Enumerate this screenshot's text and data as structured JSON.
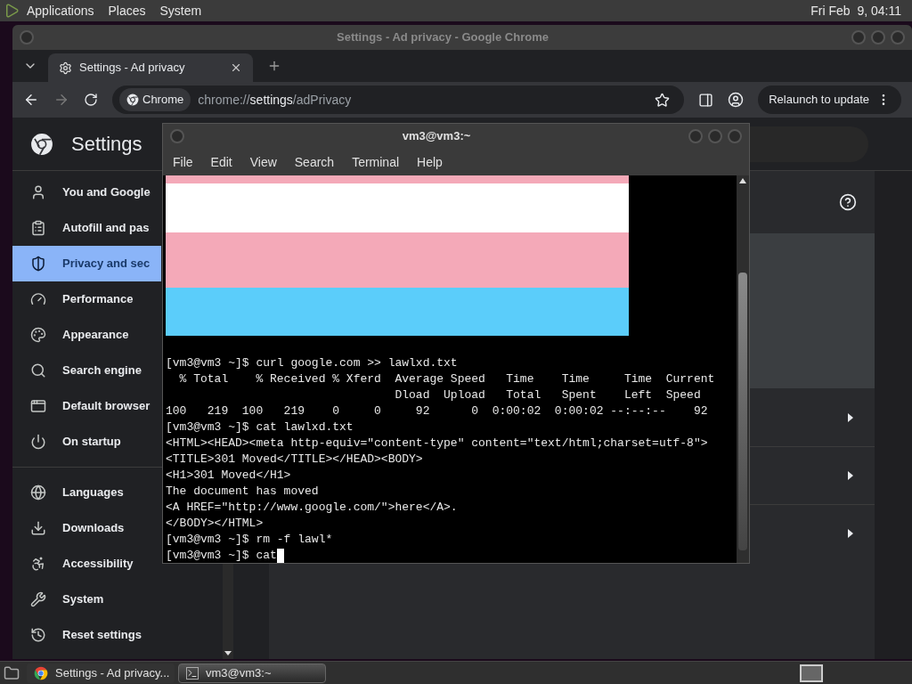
{
  "top_panel": {
    "menus": [
      "Applications",
      "Places",
      "System"
    ],
    "clock": "Fri Feb  9, 04:11"
  },
  "browser": {
    "title": "Settings - Ad privacy - Google Chrome",
    "tab": {
      "label": "Settings - Ad privacy",
      "selected": true
    },
    "omnibox": {
      "chip": "Chrome",
      "url_scheme": "chrome://",
      "url_host": "settings",
      "url_path": "/adPrivacy"
    },
    "relaunch_button": "Relaunch to update",
    "settings": {
      "title": "Settings",
      "nav": [
        {
          "label": "You and Google",
          "selected": false
        },
        {
          "label": "Autofill and pas",
          "selected": false
        },
        {
          "label": "Privacy and sec",
          "selected": true
        },
        {
          "label": "Performance",
          "selected": false
        },
        {
          "label": "Appearance",
          "selected": false
        },
        {
          "label": "Search engine",
          "selected": false
        },
        {
          "label": "Default browser",
          "selected": false
        },
        {
          "label": "On startup",
          "selected": false
        },
        {
          "label": "Languages",
          "selected": false
        },
        {
          "label": "Downloads",
          "selected": false
        },
        {
          "label": "Accessibility",
          "selected": false
        },
        {
          "label": "System",
          "selected": false
        },
        {
          "label": "Reset settings",
          "selected": false
        }
      ]
    }
  },
  "terminal": {
    "title": "vm3@vm3:~",
    "menus": [
      "File",
      "Edit",
      "View",
      "Search",
      "Terminal",
      "Help"
    ],
    "lines": [
      "[vm3@vm3 ~]$ curl google.com >> lawlxd.txt",
      "  % Total    % Received % Xferd  Average Speed   Time    Time     Time  Current",
      "                                 Dload  Upload   Total   Spent    Left  Speed",
      "100   219  100   219    0     0     92      0  0:00:02  0:00:02 --:--:--    92",
      "[vm3@vm3 ~]$ cat lawlxd.txt",
      "<HTML><HEAD><meta http-equiv=\"content-type\" content=\"text/html;charset=utf-8\">",
      "<TITLE>301 Moved</TITLE></HEAD><BODY>",
      "<H1>301 Moved</H1>",
      "The document has moved",
      "<A HREF=\"http://www.google.com/\">here</A>.",
      "</BODY></HTML>",
      "[vm3@vm3 ~]$ rm -f lawl*",
      "[vm3@vm3 ~]$ cat"
    ]
  },
  "taskbar": {
    "items": [
      {
        "label": "Settings - Ad privacy...",
        "selected": false
      },
      {
        "label": "vm3@vm3:~",
        "selected": true
      }
    ]
  }
}
